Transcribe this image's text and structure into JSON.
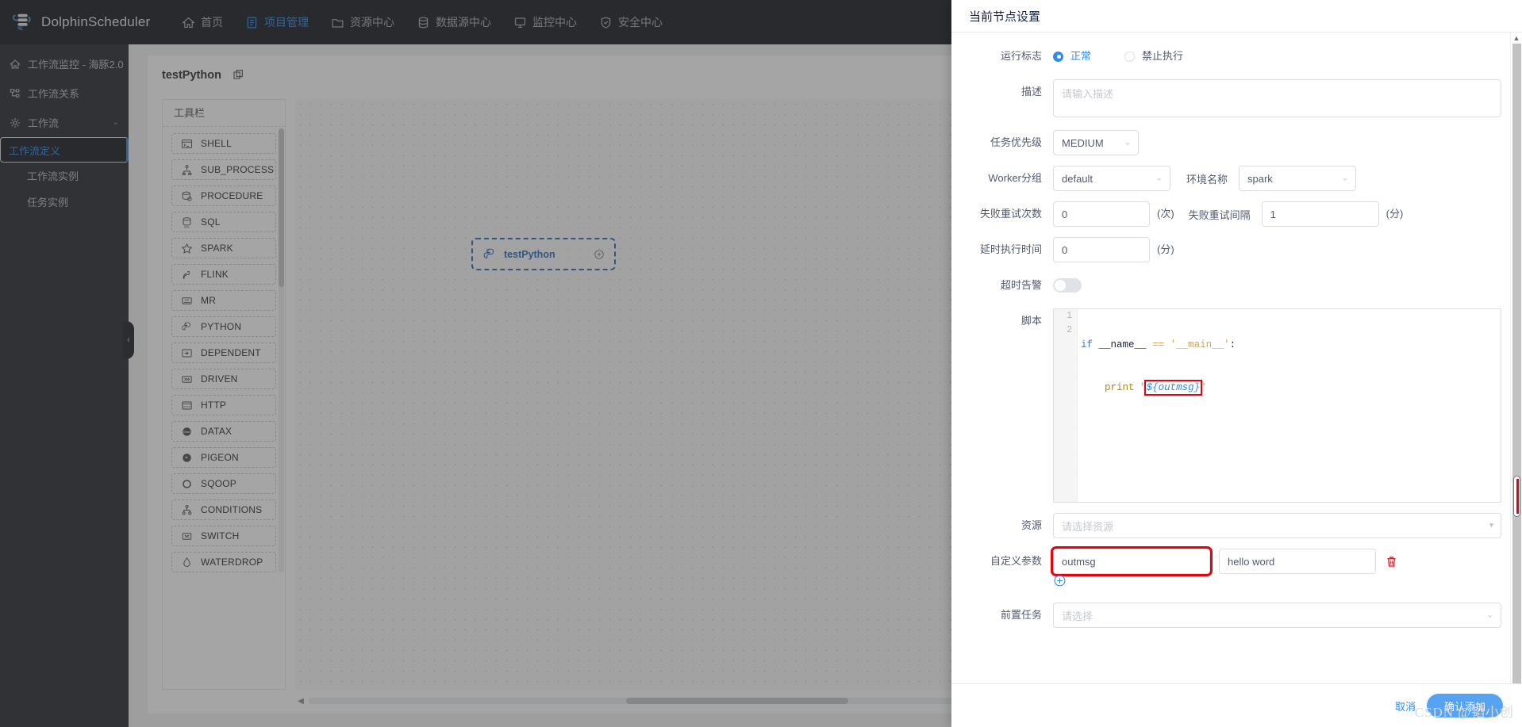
{
  "topnav": {
    "brand": "DolphinScheduler",
    "items": [
      {
        "label": "首页",
        "icon": "home-icon",
        "active": false
      },
      {
        "label": "项目管理",
        "icon": "project-icon",
        "active": true
      },
      {
        "label": "资源中心",
        "icon": "folder-icon",
        "active": false
      },
      {
        "label": "数据源中心",
        "icon": "database-icon",
        "active": false
      },
      {
        "label": "监控中心",
        "icon": "monitor-icon",
        "active": false
      },
      {
        "label": "安全中心",
        "icon": "shield-check-icon",
        "active": false
      }
    ]
  },
  "sidebar": {
    "items": [
      {
        "label": "工作流监控 - 海豚2.0",
        "icon": "home-icon"
      },
      {
        "label": "工作流关系",
        "icon": "relation-icon"
      },
      {
        "label": "工作流",
        "icon": "gear-icon",
        "expanded": true
      }
    ],
    "sub_items": [
      {
        "label": "工作流定义",
        "selected": true
      },
      {
        "label": "工作流实例",
        "selected": false
      },
      {
        "label": "任务实例",
        "selected": false
      }
    ]
  },
  "page": {
    "title": "testPython"
  },
  "toolbar": {
    "title": "工具栏",
    "items": [
      {
        "label": "SHELL",
        "icon": "terminal-icon"
      },
      {
        "label": "SUB_PROCESS",
        "icon": "subprocess-icon"
      },
      {
        "label": "PROCEDURE",
        "icon": "procedure-db-icon"
      },
      {
        "label": "SQL",
        "icon": "sql-db-icon"
      },
      {
        "label": "SPARK",
        "icon": "star-icon"
      },
      {
        "label": "FLINK",
        "icon": "squirrel-icon"
      },
      {
        "label": "MR",
        "icon": "mapreduce-icon"
      },
      {
        "label": "PYTHON",
        "icon": "python-icon"
      },
      {
        "label": "DEPENDENT",
        "icon": "dependent-icon"
      },
      {
        "label": "DRIVEN",
        "icon": "driven-icon"
      },
      {
        "label": "HTTP",
        "icon": "http-icon"
      },
      {
        "label": "DATAX",
        "icon": "datax-icon"
      },
      {
        "label": "PIGEON",
        "icon": "pigeon-icon"
      },
      {
        "label": "SQOOP",
        "icon": "sqoop-ring-icon"
      },
      {
        "label": "CONDITIONS",
        "icon": "conditions-icon"
      },
      {
        "label": "SWITCH",
        "icon": "switch-icon"
      },
      {
        "label": "WATERDROP",
        "icon": "waterdrop-icon"
      }
    ]
  },
  "canvas": {
    "node": {
      "label": "testPython",
      "icon": "python-icon",
      "add_icon": "plus-circle-icon"
    }
  },
  "drawer": {
    "title": "当前节点设置",
    "run_flag": {
      "label": "运行标志",
      "options": [
        {
          "label": "正常",
          "selected": true
        },
        {
          "label": "禁止执行",
          "selected": false
        }
      ]
    },
    "description": {
      "label": "描述",
      "placeholder": "请输入描述",
      "value": ""
    },
    "priority": {
      "label": "任务优先级",
      "value": "MEDIUM"
    },
    "worker_group": {
      "label": "Worker分组",
      "value": "default"
    },
    "environment": {
      "label": "环境名称",
      "value": "spark"
    },
    "retry_times": {
      "label": "失败重试次数",
      "value": "0",
      "suffix": "(次)"
    },
    "retry_interval": {
      "label": "失败重试间隔",
      "value": "1",
      "suffix": "(分)"
    },
    "delay_time": {
      "label": "延时执行时间",
      "value": "0",
      "suffix": "(分)"
    },
    "timeout_alarm": {
      "label": "超时告警",
      "enabled": false
    },
    "script": {
      "label": "脚本",
      "lines": [
        {
          "num": "1",
          "text": "if __name__ == '__main__':"
        },
        {
          "num": "2",
          "text": "    print \"${outmsg}\""
        }
      ],
      "highlight_token": "${outmsg}"
    },
    "resource": {
      "label": "资源",
      "placeholder": "请选择资源",
      "value": ""
    },
    "custom_params": {
      "label": "自定义参数",
      "rows": [
        {
          "key": "outmsg",
          "value": "hello word",
          "delete_icon": "trash-icon"
        }
      ],
      "add_icon": "plus-circle-icon"
    },
    "pre_tasks": {
      "label": "前置任务",
      "placeholder": "请选择",
      "value": ""
    },
    "footer": {
      "cancel": "取消",
      "confirm": "确认添加"
    }
  },
  "watermark": {
    "text": "CSDN @韬小创"
  }
}
